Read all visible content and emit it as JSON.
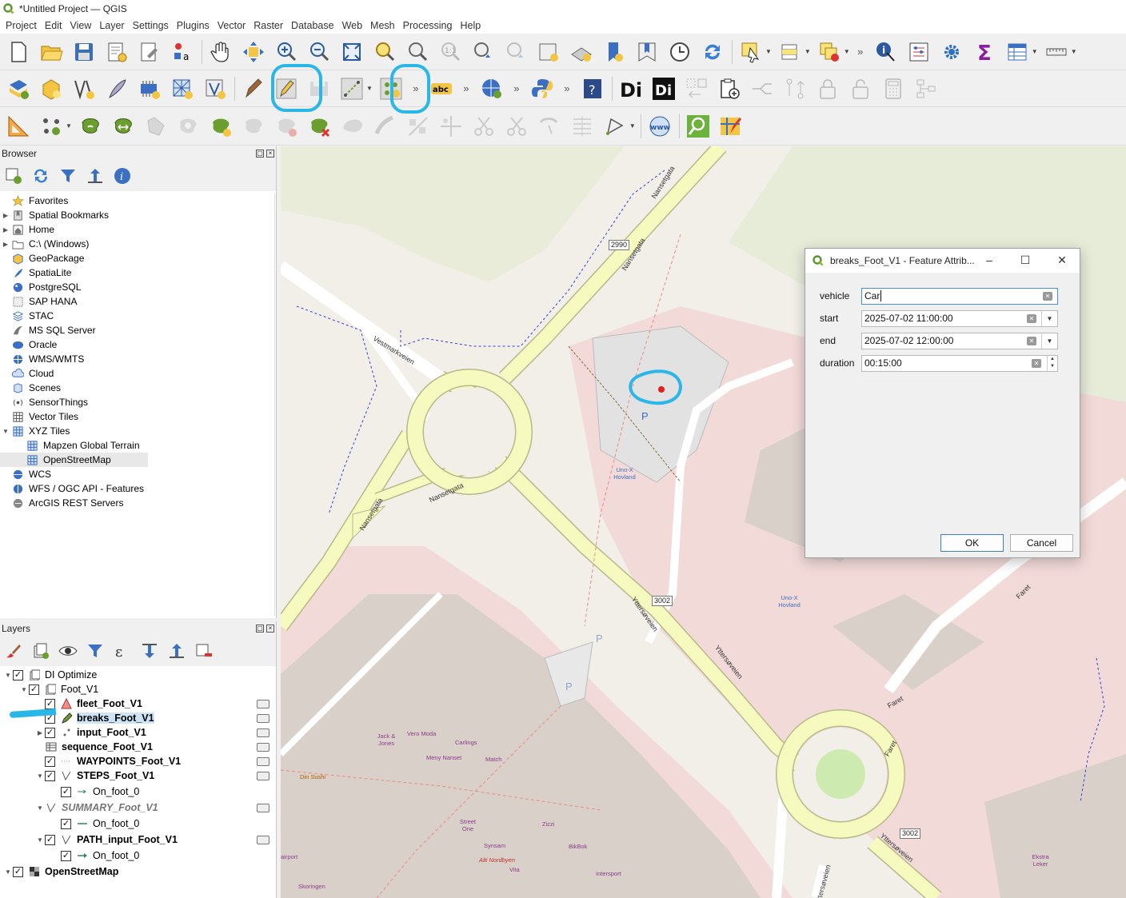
{
  "window": {
    "title": "*Untitled Project — QGIS"
  },
  "menu": [
    "Project",
    "Edit",
    "View",
    "Layer",
    "Settings",
    "Plugins",
    "Vector",
    "Raster",
    "Database",
    "Web",
    "Mesh",
    "Processing",
    "Help"
  ],
  "browser": {
    "title": "Browser",
    "items": [
      {
        "label": "Favorites",
        "icon": "star-icon",
        "arrow": ""
      },
      {
        "label": "Spatial Bookmarks",
        "icon": "bookmark-icon",
        "arrow": "▶"
      },
      {
        "label": "Home",
        "icon": "home-icon",
        "arrow": "▶"
      },
      {
        "label": "C:\\ (Windows)",
        "icon": "folder-icon",
        "arrow": "▶"
      },
      {
        "label": "GeoPackage",
        "icon": "geopackage-icon",
        "arrow": ""
      },
      {
        "label": "SpatiaLite",
        "icon": "spatialite-icon",
        "arrow": ""
      },
      {
        "label": "PostgreSQL",
        "icon": "postgresql-icon",
        "arrow": ""
      },
      {
        "label": "SAP HANA",
        "icon": "sap-hana-icon",
        "arrow": ""
      },
      {
        "label": "STAC",
        "icon": "stac-icon",
        "arrow": ""
      },
      {
        "label": "MS SQL Server",
        "icon": "mssql-icon",
        "arrow": ""
      },
      {
        "label": "Oracle",
        "icon": "oracle-icon",
        "arrow": ""
      },
      {
        "label": "WMS/WMTS",
        "icon": "wms-icon",
        "arrow": ""
      },
      {
        "label": "Cloud",
        "icon": "cloud-icon",
        "arrow": ""
      },
      {
        "label": "Scenes",
        "icon": "scenes-icon",
        "arrow": ""
      },
      {
        "label": "SensorThings",
        "icon": "sensorthings-icon",
        "arrow": ""
      },
      {
        "label": "Vector Tiles",
        "icon": "vector-tiles-icon",
        "arrow": ""
      },
      {
        "label": "XYZ Tiles",
        "icon": "xyz-tiles-icon",
        "arrow": "▼"
      },
      {
        "label": "Mapzen Global Terrain",
        "icon": "xyz-tile-icon",
        "arrow": "",
        "indent": true
      },
      {
        "label": "OpenStreetMap",
        "icon": "xyz-tile-icon",
        "arrow": "",
        "indent": true,
        "selected": true
      },
      {
        "label": "WCS",
        "icon": "wcs-icon",
        "arrow": ""
      },
      {
        "label": "WFS / OGC API - Features",
        "icon": "wfs-icon",
        "arrow": ""
      },
      {
        "label": "ArcGIS REST Servers",
        "icon": "arcgis-icon",
        "arrow": ""
      }
    ]
  },
  "layers": {
    "title": "Layers",
    "rows": [
      {
        "label": "DI Optimize",
        "level": 0,
        "arrow": "▼",
        "checked": true,
        "style": "normal",
        "icon": "group-icon"
      },
      {
        "label": "Foot_V1",
        "level": 1,
        "arrow": "▼",
        "checked": true,
        "style": "normal",
        "icon": "group-icon"
      },
      {
        "label": "fleet_Foot_V1",
        "level": 2,
        "arrow": "",
        "checked": true,
        "style": "bold",
        "icon": "triangle-point-icon",
        "edit": true
      },
      {
        "label": "breaks_Foot_V1",
        "level": 2,
        "arrow": "",
        "checked": true,
        "style": "bold",
        "icon": "pencil-editing-icon",
        "edit": true,
        "selected": true
      },
      {
        "label": "input_Foot_V1",
        "level": 2,
        "arrow": "▶",
        "checked": true,
        "style": "bold",
        "icon": "point-layer-icon",
        "edit": true
      },
      {
        "label": "sequence_Foot_V1",
        "level": 2,
        "arrow": "",
        "checked": null,
        "style": "bold",
        "icon": "table-icon",
        "edit": true
      },
      {
        "label": "WAYPOINTS_Foot_V1",
        "level": 2,
        "arrow": "",
        "checked": true,
        "style": "bold",
        "icon": "dotted-line-icon",
        "edit": true
      },
      {
        "label": "STEPS_Foot_V1",
        "level": 2,
        "arrow": "▼",
        "checked": true,
        "style": "bold",
        "icon": "line-layer-icon",
        "edit": true
      },
      {
        "label": "On_foot_0",
        "level": 3,
        "arrow": "",
        "checked": true,
        "style": "normal",
        "icon": "arrow-line-icon"
      },
      {
        "label": "SUMMARY_Foot_V1",
        "level": 2,
        "arrow": "▼",
        "checked": null,
        "style": "italic",
        "icon": "line-layer-icon",
        "edit": true
      },
      {
        "label": "On_foot_0",
        "level": 3,
        "arrow": "",
        "checked": true,
        "style": "normal",
        "icon": "green-line-icon"
      },
      {
        "label": "PATH_input_Foot_V1",
        "level": 2,
        "arrow": "▼",
        "checked": true,
        "style": "bold",
        "icon": "line-layer-icon",
        "edit": true
      },
      {
        "label": "On_foot_0",
        "level": 3,
        "arrow": "",
        "checked": true,
        "style": "normal",
        "icon": "green-arrow-icon"
      },
      {
        "label": "OpenStreetMap",
        "level": 0,
        "arrow": "▼",
        "checked": true,
        "style": "bold",
        "icon": "raster-icon"
      }
    ]
  },
  "dialog": {
    "title": "breaks_Foot_V1 - Feature Attrib...",
    "fields": [
      {
        "label": "vehicle",
        "value": "Car",
        "kind": "text"
      },
      {
        "label": "start",
        "value": "2025-07-02 11:00:00",
        "kind": "datetime"
      },
      {
        "label": "end",
        "value": "2025-07-02 12:00:00",
        "kind": "datetime"
      },
      {
        "label": "duration",
        "value": "00:15:00",
        "kind": "time"
      }
    ],
    "ok_label": "OK",
    "cancel_label": "Cancel"
  },
  "map": {
    "street_labels": [
      "Nansetgata",
      "Nansetgata",
      "Vestmarkveien",
      "Nansetgata",
      "Nansetgata",
      "Yttersøveien",
      "Yttersøveien",
      "Yttersøveien",
      "Faret",
      "Faret",
      "Faret",
      "Yttersøveien"
    ],
    "shields": [
      "2990",
      "3002",
      "3002"
    ],
    "poi_labels": [
      "Uno-X Hovland",
      "Uno-X Hovland",
      "Jack & Jones",
      "Vero Moda",
      "Carlings",
      "Meny Nanset",
      "Match",
      "Din Sushi",
      "Street One",
      "Zizzi",
      "Synsam",
      "BikBok",
      "Alti Nordbyen",
      "Vita",
      "Intersport",
      "airport",
      "Skoringen",
      "Ekstra Leker"
    ],
    "parking": [
      "P",
      "P",
      "P"
    ],
    "colors": {
      "road": "#f7fabf",
      "road_edge": "#b7b98a",
      "retail": "#f2dad9",
      "grass": "#e5ecd9",
      "roundabout_green": "#cdebb0",
      "highlight": "#29b6e8"
    }
  }
}
